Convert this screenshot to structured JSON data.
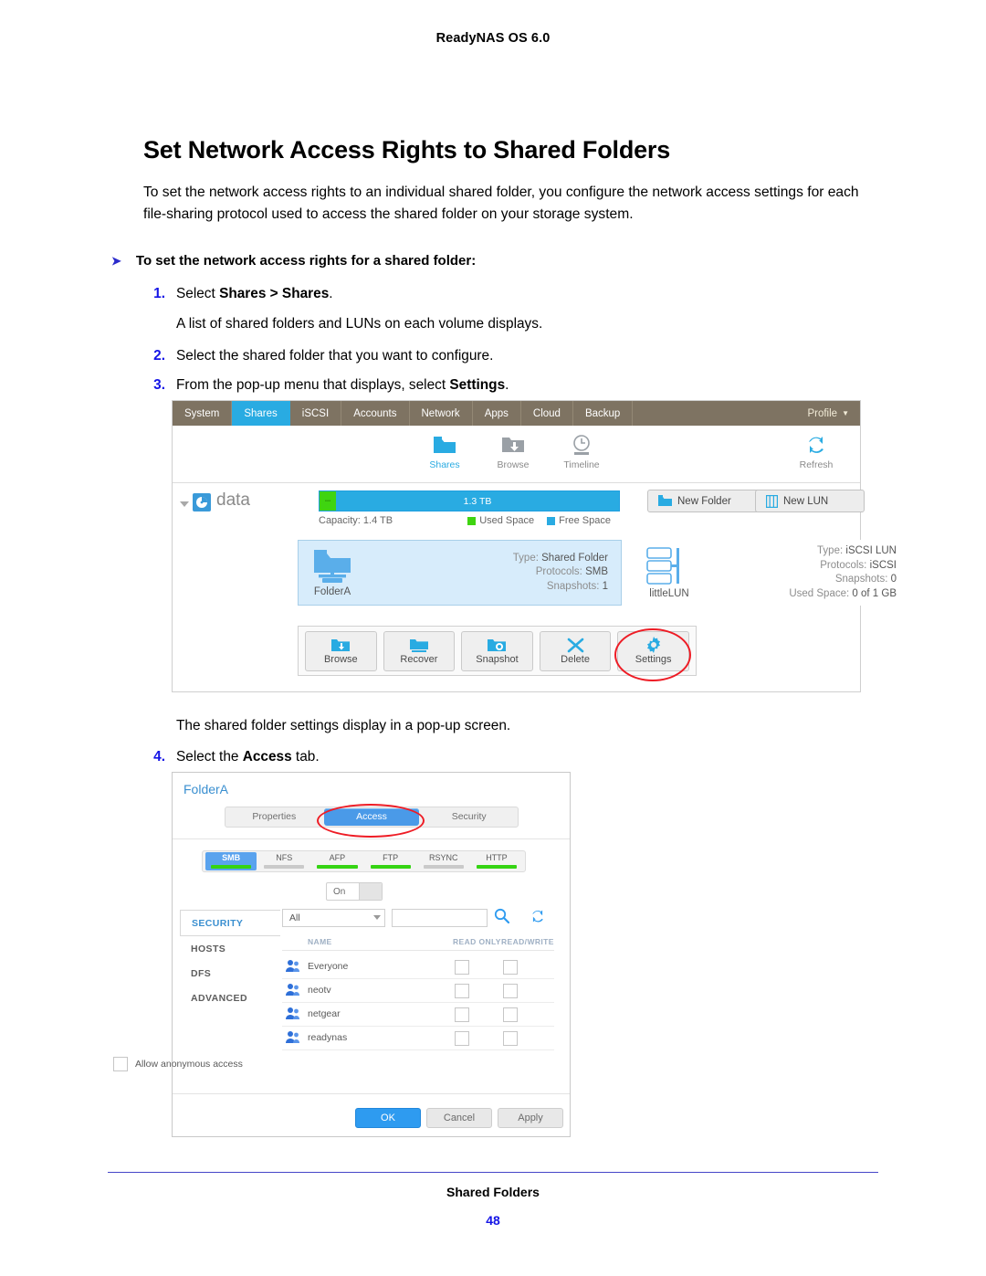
{
  "document": {
    "header": "ReadyNAS OS 6.0",
    "title": "Set Network Access Rights to Shared Folders",
    "intro": "To set the network access rights to an individual shared folder, you configure the network access settings for each file-sharing protocol used to access the shared folder on your storage system.",
    "procedure_heading": "To set the network access rights for a shared folder:",
    "steps": [
      {
        "num": "1.",
        "pre": "Select ",
        "bold": "Shares > Shares",
        "post": "."
      },
      {
        "num": "2.",
        "pre": "Select the shared folder that you want to configure.",
        "bold": "",
        "post": ""
      },
      {
        "num": "3.",
        "pre": "From the pop-up menu that displays, select ",
        "bold": "Settings",
        "post": "."
      },
      {
        "num": "4.",
        "pre": "Select the ",
        "bold": "Access",
        "post": " tab."
      }
    ],
    "note_after_step1": "A list of shared folders and LUNs on each volume displays.",
    "note_after_step3": "The shared folder settings display in a pop-up screen.",
    "footer_title": "Shared Folders",
    "page_number": "48"
  },
  "colors": {
    "accent_blue": "#29abe2",
    "nav_brown": "#7e7362",
    "used_green": "#3fd410",
    "free_blue": "#29abe2",
    "annotation_red": "#ee1c25",
    "page_number_blue": "#1414e6"
  },
  "shares_screen": {
    "nav_tabs": [
      {
        "label": "System",
        "active": false
      },
      {
        "label": "Shares",
        "active": true
      },
      {
        "label": "iSCSI",
        "active": false
      },
      {
        "label": "Accounts",
        "active": false
      },
      {
        "label": "Network",
        "active": false
      },
      {
        "label": "Apps",
        "active": false
      },
      {
        "label": "Cloud",
        "active": false
      },
      {
        "label": "Backup",
        "active": false
      }
    ],
    "profile_label": "Profile",
    "toolbar": [
      {
        "label": "Shares",
        "icon": "folder-icon",
        "selected": true
      },
      {
        "label": "Browse",
        "icon": "browse-folder-icon",
        "selected": false
      },
      {
        "label": "Timeline",
        "icon": "clock-icon",
        "selected": false
      },
      {
        "label": "Refresh",
        "icon": "refresh-icon",
        "selected": false
      }
    ],
    "volume": {
      "name": "data",
      "bar_label": "1.3 TB",
      "capacity_label": "Capacity: 1.4 TB",
      "legend": [
        {
          "label": "Used Space",
          "color": "#3fd410"
        },
        {
          "label": "Free Space",
          "color": "#29abe2"
        }
      ]
    },
    "header_buttons": [
      {
        "label": "New Folder",
        "icon": "new-folder-icon"
      },
      {
        "label": "New LUN",
        "icon": "new-lun-icon"
      }
    ],
    "items": [
      {
        "name": "FolderA",
        "icon": "shared-folder-icon",
        "selected": true,
        "details": [
          {
            "key": "Type:",
            "value": "Shared Folder"
          },
          {
            "key": "Protocols:",
            "value": "SMB"
          },
          {
            "key": "Snapshots:",
            "value": "1"
          }
        ]
      },
      {
        "name": "littleLUN",
        "icon": "lun-icon",
        "selected": false,
        "details": [
          {
            "key": "Type:",
            "value": "iSCSI LUN"
          },
          {
            "key": "Protocols:",
            "value": "iSCSI"
          },
          {
            "key": "Snapshots:",
            "value": "0"
          },
          {
            "key": "Used Space:",
            "value": "0 of 1 GB"
          }
        ]
      }
    ],
    "popup_actions": [
      {
        "label": "Browse",
        "icon": "browse-icon",
        "highlighted": false
      },
      {
        "label": "Recover",
        "icon": "recover-icon",
        "highlighted": false
      },
      {
        "label": "Snapshot",
        "icon": "snapshot-icon",
        "highlighted": false
      },
      {
        "label": "Delete",
        "icon": "delete-x-icon",
        "highlighted": false
      },
      {
        "label": "Settings",
        "icon": "gear-icon",
        "highlighted": true
      }
    ]
  },
  "settings_dialog": {
    "title": "FolderA",
    "tabs": [
      {
        "label": "Properties",
        "active": false
      },
      {
        "label": "Access",
        "active": true
      },
      {
        "label": "Security",
        "active": false
      }
    ],
    "protocols": [
      {
        "label": "SMB",
        "active": true,
        "enabled": true
      },
      {
        "label": "NFS",
        "active": false,
        "enabled": false
      },
      {
        "label": "AFP",
        "active": false,
        "enabled": true
      },
      {
        "label": "FTP",
        "active": false,
        "enabled": true
      },
      {
        "label": "RSYNC",
        "active": false,
        "enabled": false
      },
      {
        "label": "HTTP",
        "active": false,
        "enabled": true
      }
    ],
    "toggle_label": "On",
    "sidebar": [
      {
        "label": "SECURITY",
        "active": true
      },
      {
        "label": "HOSTS",
        "active": false
      },
      {
        "label": "DFS",
        "active": false
      },
      {
        "label": "ADVANCED",
        "active": false
      }
    ],
    "filter_value": "All",
    "search_value": "",
    "search_icon": "magnifier-icon",
    "refresh_icon": "refresh-icon",
    "table_headers": [
      "NAME",
      "READ ONLY",
      "READ/WRITE"
    ],
    "rows": [
      {
        "name": "Everyone",
        "icon": "group-icon",
        "read_only": false,
        "read_write": false
      },
      {
        "name": "neotv",
        "icon": "group-icon",
        "read_only": false,
        "read_write": false
      },
      {
        "name": "netgear",
        "icon": "group-icon",
        "read_only": false,
        "read_write": false
      },
      {
        "name": "readynas",
        "icon": "group-icon",
        "read_only": false,
        "read_write": false
      }
    ],
    "anonymous_label": "Allow anonymous access",
    "anonymous_checked": false,
    "buttons": [
      {
        "label": "OK",
        "primary": true
      },
      {
        "label": "Cancel",
        "primary": false
      },
      {
        "label": "Apply",
        "primary": false
      }
    ]
  }
}
